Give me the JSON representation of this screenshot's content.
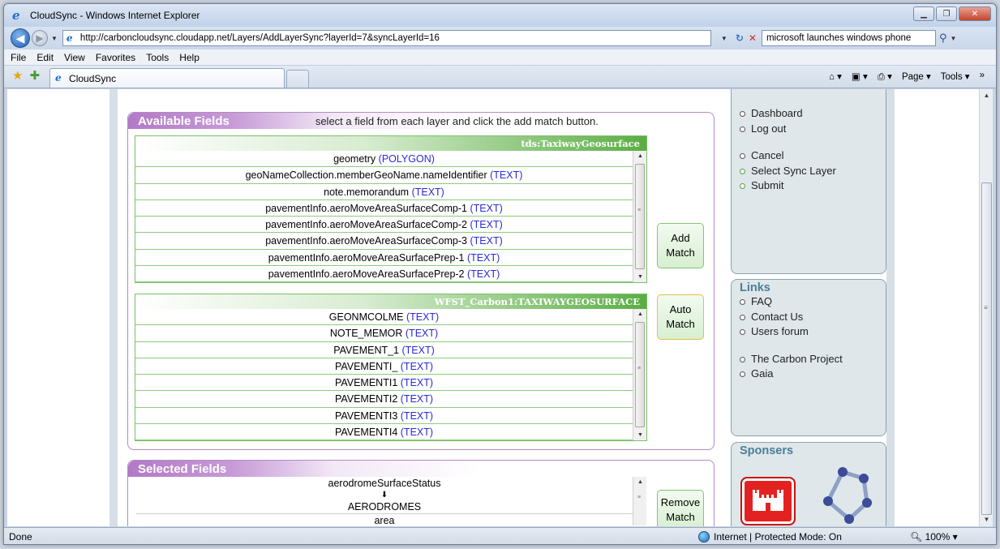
{
  "window": {
    "title": "CloudSync - Windows Internet Explorer"
  },
  "address": {
    "url": "http://carboncloudsync.cloudapp.net/Layers/AddLayerSync?layerId=7&syncLayerId=16",
    "search": "microsoft launches windows phone"
  },
  "menu": {
    "items": [
      "File",
      "Edit",
      "View",
      "Favorites",
      "Tools",
      "Help"
    ]
  },
  "tab": {
    "title": "CloudSync"
  },
  "command_bar": {
    "page": "Page ▾",
    "tools": "Tools ▾"
  },
  "available": {
    "title": "Available Fields",
    "hint": "select a field from each layer and click the add match button.",
    "source_layer": "tds:TaxiwayGeosurface",
    "source_fields": [
      {
        "name": "geometry",
        "type": "(POLYGON)"
      },
      {
        "name": "geoNameCollection.memberGeoName.nameIdentifier",
        "type": "(TEXT)"
      },
      {
        "name": "note.memorandum",
        "type": "(TEXT)"
      },
      {
        "name": "pavementInfo.aeroMoveAreaSurfaceComp-1",
        "type": "(TEXT)"
      },
      {
        "name": "pavementInfo.aeroMoveAreaSurfaceComp-2",
        "type": "(TEXT)"
      },
      {
        "name": "pavementInfo.aeroMoveAreaSurfaceComp-3",
        "type": "(TEXT)"
      },
      {
        "name": "pavementInfo.aeroMoveAreaSurfacePrep-1",
        "type": "(TEXT)"
      },
      {
        "name": "pavementInfo.aeroMoveAreaSurfacePrep-2",
        "type": "(TEXT)"
      }
    ],
    "target_layer": "WFST_Carbon1:TAXIWAYGEOSURFACE",
    "target_fields": [
      {
        "name": "GEONMCOLME",
        "type": "(TEXT)"
      },
      {
        "name": "NOTE_MEMOR",
        "type": "(TEXT)"
      },
      {
        "name": "PAVEMENT_1",
        "type": "(TEXT)"
      },
      {
        "name": "PAVEMENTI_",
        "type": "(TEXT)"
      },
      {
        "name": "PAVEMENTI1",
        "type": "(TEXT)"
      },
      {
        "name": "PAVEMENTI2",
        "type": "(TEXT)"
      },
      {
        "name": "PAVEMENTI3",
        "type": "(TEXT)"
      },
      {
        "name": "PAVEMENTI4",
        "type": "(TEXT)"
      }
    ],
    "add_match": [
      "Add",
      "Match"
    ],
    "auto_match": [
      "Auto",
      "Match"
    ]
  },
  "selected": {
    "title": "Selected Fields",
    "source": "aerodromeSurfaceStatus",
    "target": "AERODROMES",
    "next": "area",
    "remove_match": [
      "Remove",
      "Match"
    ]
  },
  "sidebar": {
    "nav": [
      "Dashboard",
      "Log out"
    ],
    "actions": [
      "Cancel",
      "Select Sync Layer",
      "Submit"
    ],
    "links_title": "Links",
    "links": [
      "FAQ",
      "Contact Us",
      "Users forum"
    ],
    "external": [
      "The Carbon Project",
      "Gaia"
    ],
    "sponsors_title": "Sponsers"
  },
  "status": {
    "left": "Done",
    "zone": "Internet | Protected Mode: On",
    "zoom": "100%"
  }
}
